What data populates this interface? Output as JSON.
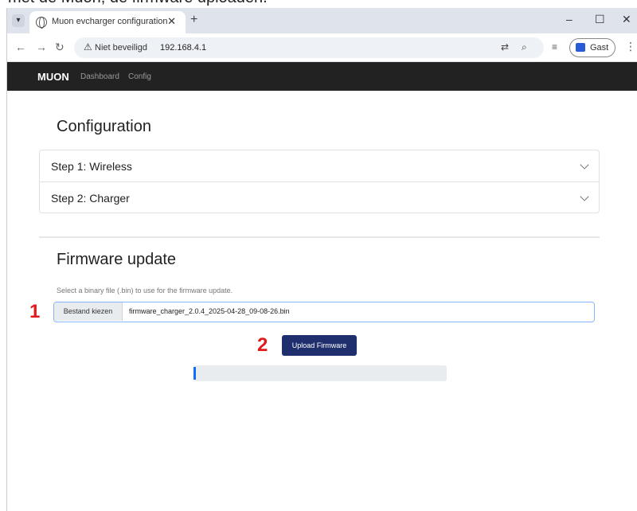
{
  "caption": "met de Muon, de firmware uploaden.",
  "browser": {
    "tab_title": "Muon evcharger configuration",
    "tab_close": "✕",
    "new_tab": "+",
    "security_label": "Niet beveiligd",
    "url": "192.168.4.1",
    "profile_label": "Gast",
    "window_controls": [
      "–",
      "☐",
      "✕"
    ]
  },
  "navbar": {
    "brand": "MUON",
    "links": [
      "Dashboard",
      "Config"
    ]
  },
  "configuration": {
    "heading": "Configuration",
    "steps": [
      "Step 1: Wireless",
      "Step 2: Charger"
    ]
  },
  "firmware": {
    "heading": "Firmware update",
    "help_text": "Select a binary file (.bin) to use for the firmware update.",
    "file_button": "Bestand kiezen",
    "file_name": "firmware_charger_2.0.4_2025-04-28_09-08-26.bin",
    "upload_button": "Upload Firmware",
    "progress_fraction": 0.01
  },
  "annotations": {
    "marker_1": "1",
    "marker_2": "2",
    "color": "#e01b1b"
  },
  "colors": {
    "navbar_bg": "#222222",
    "button_bg": "#1f2f6e",
    "progress_fill": "#0d6efd"
  }
}
